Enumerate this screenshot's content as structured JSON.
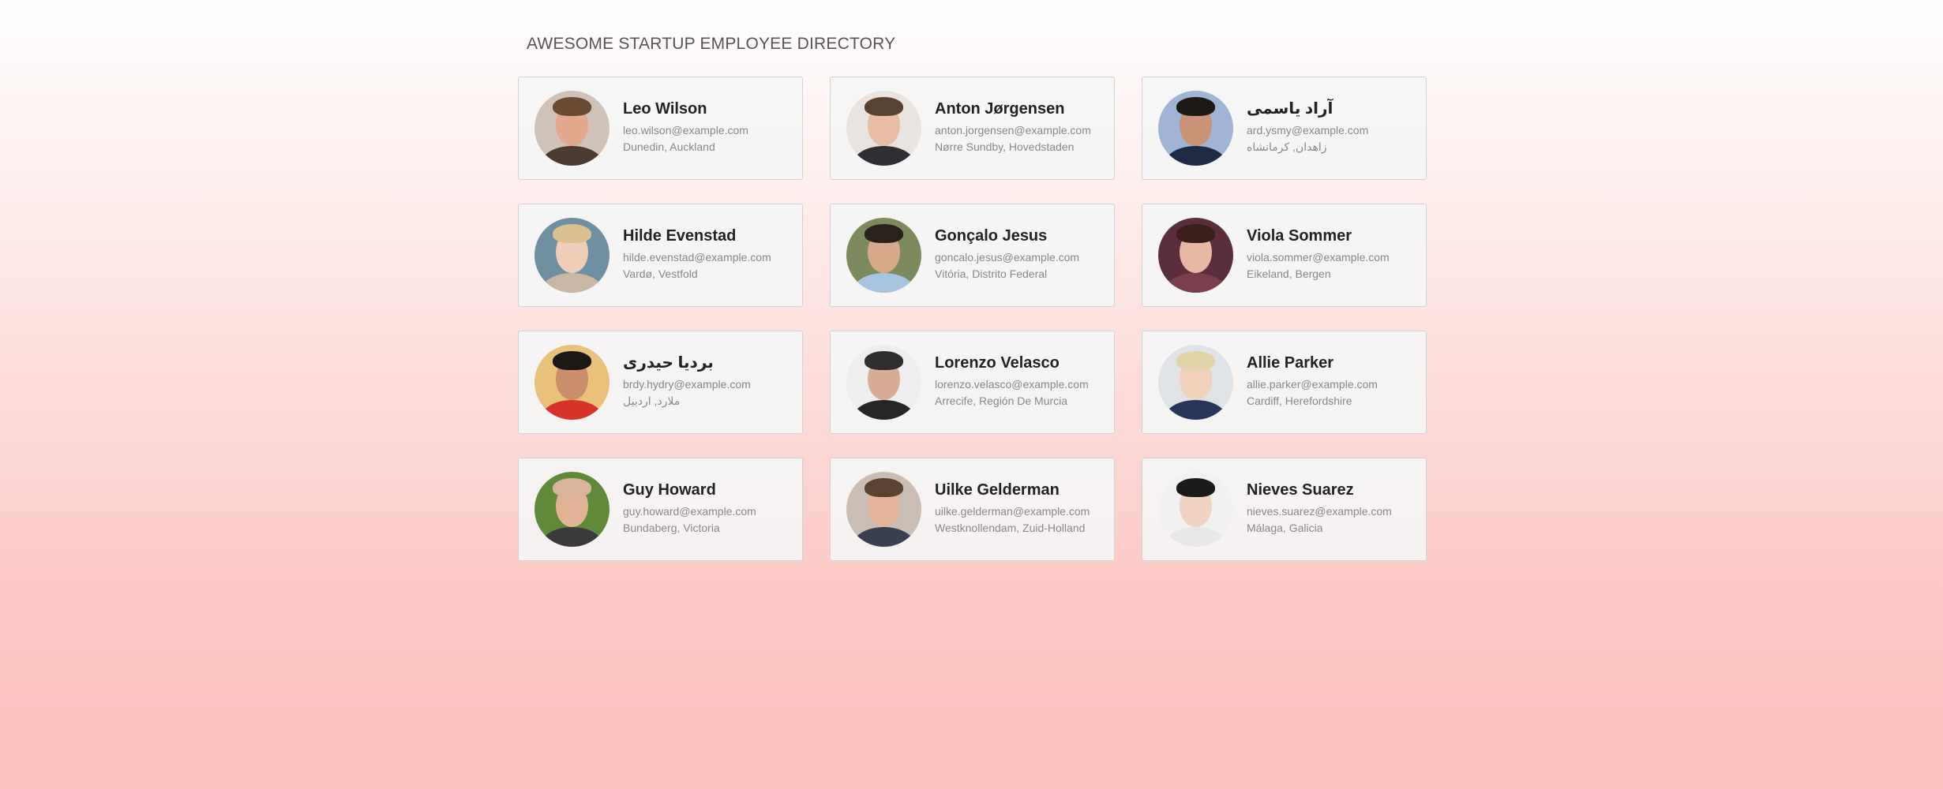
{
  "page": {
    "title": "AWESOME STARTUP EMPLOYEE DIRECTORY"
  },
  "employees": [
    {
      "name": "Leo Wilson",
      "email": "leo.wilson@example.com",
      "location": "Dunedin, Auckland"
    },
    {
      "name": "Anton Jørgensen",
      "email": "anton.jorgensen@example.com",
      "location": "Nørre Sundby, Hovedstaden"
    },
    {
      "name": "آراد یاسمی",
      "email": "ard.ysmy@example.com",
      "location": "زاهدان, کرمانشاه"
    },
    {
      "name": "Hilde Evenstad",
      "email": "hilde.evenstad@example.com",
      "location": "Vardø, Vestfold"
    },
    {
      "name": "Gonçalo Jesus",
      "email": "goncalo.jesus@example.com",
      "location": "Vitória, Distrito Federal"
    },
    {
      "name": "Viola Sommer",
      "email": "viola.sommer@example.com",
      "location": "Eikeland, Bergen"
    },
    {
      "name": "بردیا حیدری",
      "email": "brdy.hydry@example.com",
      "location": "ملارد, اردبیل"
    },
    {
      "name": "Lorenzo Velasco",
      "email": "lorenzo.velasco@example.com",
      "location": "Arrecife, Región De Murcia"
    },
    {
      "name": "Allie Parker",
      "email": "allie.parker@example.com",
      "location": "Cardiff, Herefordshire"
    },
    {
      "name": "Guy Howard",
      "email": "guy.howard@example.com",
      "location": "Bundaberg, Victoria"
    },
    {
      "name": "Uilke Gelderman",
      "email": "uilke.gelderman@example.com",
      "location": "Westknollendam, Zuid-Holland"
    },
    {
      "name": "Nieves Suarez",
      "email": "nieves.suarez@example.com",
      "location": "Málaga, Galicia"
    }
  ]
}
